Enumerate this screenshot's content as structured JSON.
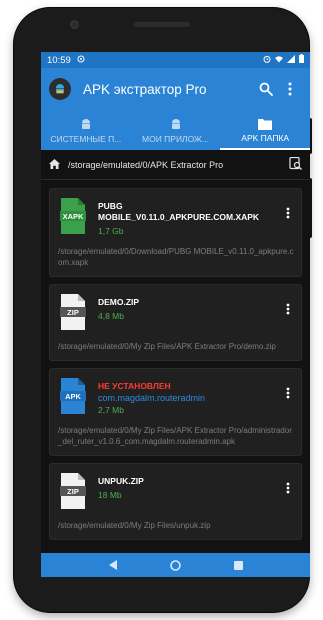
{
  "status_bar": {
    "time": "10:59"
  },
  "app": {
    "title": "APK экстрактор Pro"
  },
  "tabs": [
    {
      "label": "СИСТЕМНЫЕ П...",
      "icon": "android-icon",
      "active": false
    },
    {
      "label": "МОИ ПРИЛОЖ...",
      "icon": "android-icon",
      "active": false
    },
    {
      "label": "APK ПАПКА",
      "icon": "folder-icon",
      "active": true
    }
  ],
  "path_bar": {
    "path": "/storage/emulated/0/APK Extractor Pro"
  },
  "files": [
    {
      "type": "XAPK",
      "name": "PUBG MOBILE_V0.11.0_APKPURE.COM.XAPK",
      "size": "1,7 Gb",
      "path": "/storage/emulated/0/Download/PUBG MOBILE_v0.11.0_apkpure.com.xapk"
    },
    {
      "type": "ZIP",
      "name": "DEMO.ZIP",
      "size": "4,8 Mb",
      "path": "/storage/emulated/0/My Zip Files/APK Extractor Pro/demo.zip"
    },
    {
      "type": "APK",
      "warning": "НЕ УСТАНОВЛЕН",
      "package": "com.magdalm.routeradmin",
      "size": "2,7 Mb",
      "path": "/storage/emulated/0/My Zip Files/APK Extractor Pro/administrador_del_ruter_v1.0.6_com.magdalm.routeradmin.apk"
    },
    {
      "type": "ZIP",
      "name": "UNPUK.ZIP",
      "size": "18 Mb",
      "path": "/storage/emulated/0/My Zip Files/unpuk.zip"
    }
  ],
  "colors": {
    "primary": "#2b83d6",
    "status_bar": "#1f74c4",
    "background": "#121212",
    "card": "#202020",
    "size_green": "#4caf50",
    "warning_red": "#ff3b2f",
    "package_blue": "#2d8ae0",
    "xapk_green": "#3aa04a"
  }
}
